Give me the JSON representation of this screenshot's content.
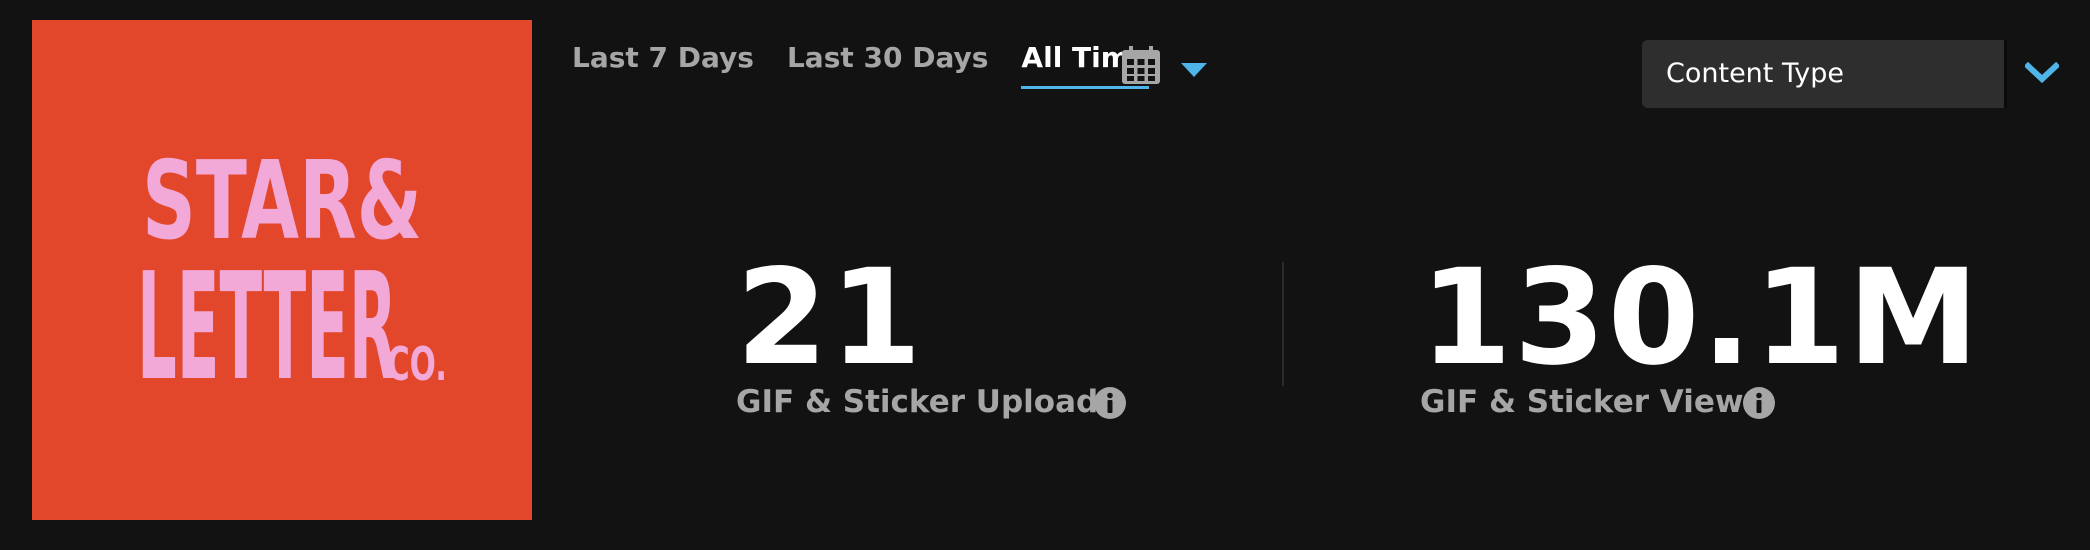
{
  "channel": {
    "logo_text": [
      "STAR&",
      "LETTER",
      "CO."
    ],
    "logo_bg_color": "#e2462b",
    "logo_text_color": "#f2a9d8"
  },
  "tabs": [
    {
      "label": "Last 7 Days",
      "active": false
    },
    {
      "label": "Last 30 Days",
      "active": false
    },
    {
      "label": "All Time",
      "active": true
    }
  ],
  "date_picker": {
    "icon": "calendar-icon",
    "dropdown_icon": "caret-down-icon"
  },
  "content_type_select": {
    "label": "Content Type",
    "icon": "chevron-down-icon"
  },
  "stats": [
    {
      "value": "21",
      "label": "GIF & Sticker Uploads",
      "icon": "info-icon"
    },
    {
      "value": "130.1M",
      "label": "GIF & Sticker Views",
      "icon": "info-icon"
    }
  ],
  "colors": {
    "background": "#121212",
    "accent": "#4fb4e8",
    "muted_text": "#a6a6a6",
    "select_bg": "#2e2e2e"
  }
}
